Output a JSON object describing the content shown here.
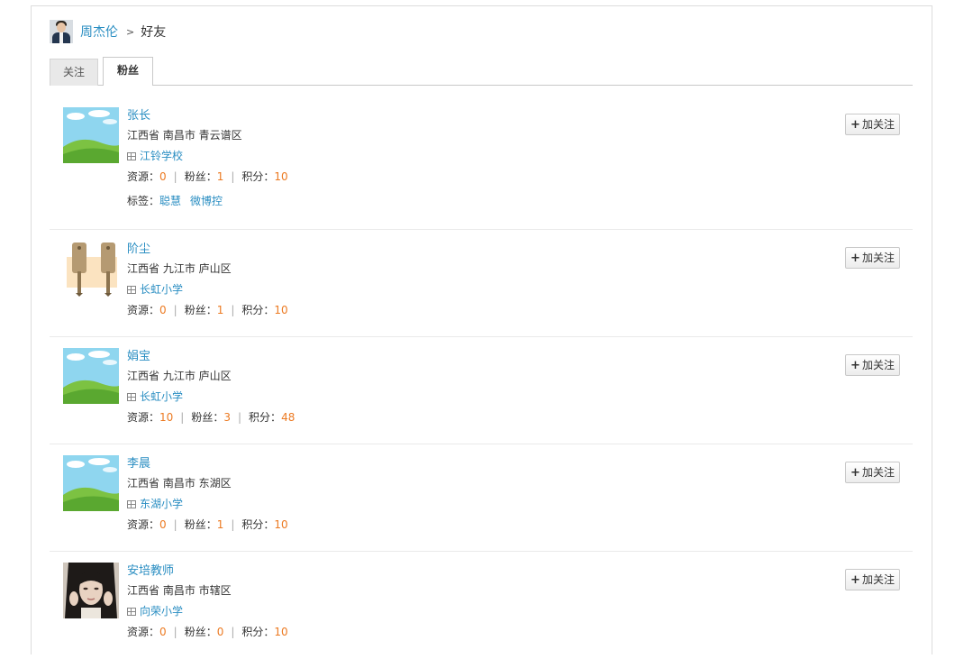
{
  "breadcrumb": {
    "user": "周杰伦",
    "separator": ">",
    "page": "好友"
  },
  "tabs": [
    {
      "label": "关注",
      "active": false
    },
    {
      "label": "粉丝",
      "active": true
    }
  ],
  "labels": {
    "resources": "资源：",
    "fans": "粉丝：",
    "points": "积分：",
    "tags": "标签：",
    "follow_button": "加关注",
    "separator": "|"
  },
  "fans": [
    {
      "name": "张长",
      "location": "江西省 南昌市 青云谱区",
      "school": "江铃学校",
      "resources": "0",
      "fans": "1",
      "points": "10",
      "tags": [
        "聪慧",
        "微博控"
      ],
      "avatar": "landscape-avatar"
    },
    {
      "name": "阶尘",
      "location": "江西省 九江市 庐山区",
      "school": "长虹小学",
      "resources": "0",
      "fans": "1",
      "points": "10",
      "tags": [],
      "avatar": "keys-avatar"
    },
    {
      "name": "娟宝",
      "location": "江西省 九江市 庐山区",
      "school": "长虹小学",
      "resources": "10",
      "fans": "3",
      "points": "48",
      "tags": [],
      "avatar": "landscape-avatar"
    },
    {
      "name": "李晨",
      "location": "江西省 南昌市 东湖区",
      "school": "东湖小学",
      "resources": "0",
      "fans": "1",
      "points": "10",
      "tags": [],
      "avatar": "landscape-avatar"
    },
    {
      "name": "安培教师",
      "location": "江西省 南昌市 市辖区",
      "school": "向荣小学",
      "resources": "0",
      "fans": "0",
      "points": "10",
      "tags": [],
      "avatar": "portrait-photo-avatar"
    }
  ],
  "colors": {
    "link": "#2a8ec2",
    "number": "#ec7a22",
    "border": "#dcdcdc"
  }
}
